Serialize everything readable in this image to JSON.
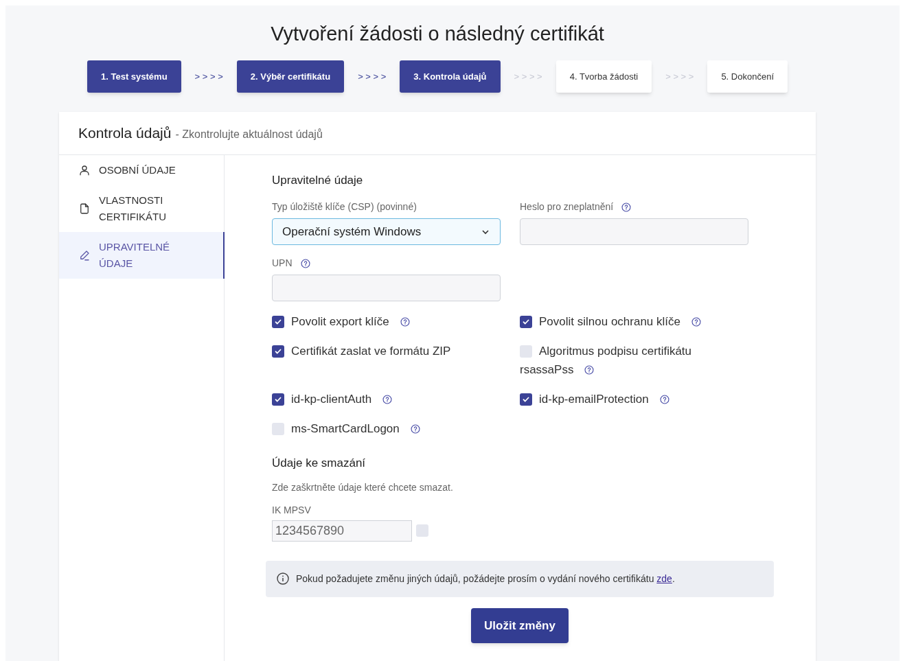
{
  "title": "Vytvoření žádosti o následný certifikát",
  "steps": [
    {
      "label": "1. Test systému",
      "done": true
    },
    {
      "separator": "> > > >",
      "active": true
    },
    {
      "label": "2. Výběr certifikátu",
      "done": true
    },
    {
      "separator": "> > > >",
      "active": true
    },
    {
      "label": "3. Kontrola údajů",
      "done": true
    },
    {
      "separator": "> > > >",
      "active": false
    },
    {
      "label": "4. Tvorba žádosti",
      "done": false
    },
    {
      "separator": "> > > >",
      "active": false
    },
    {
      "label": "5. Dokončení",
      "done": false
    }
  ],
  "card": {
    "title": "Kontrola údajů",
    "subtitle": "- Zkontrolujte aktuálnost údajů"
  },
  "sidebar": {
    "items": [
      {
        "kind": "person",
        "label": "OSOBNÍ ÚDAJE",
        "selected": false
      },
      {
        "kind": "document",
        "label": "VLASTNOSTI CERTIFIKÁTU",
        "selected": false
      },
      {
        "kind": "pencil",
        "label": "UPRAVITELNÉ ÚDAJE",
        "selected": true
      }
    ]
  },
  "editable": {
    "heading": "Upravitelné údaje",
    "fields": [
      {
        "kind": "select",
        "label": "Typ úložiště klíče (CSP) (povinné)",
        "value": "Operační systém Windows",
        "help": false
      },
      {
        "kind": "text",
        "label": "Heslo pro zneplatnění",
        "help": true
      },
      {
        "kind": "text",
        "label": "UPN",
        "help": true
      }
    ],
    "checkboxes": [
      {
        "label": "Povolit export klíče",
        "checked": true,
        "help": true
      },
      {
        "label": "Povolit silnou ochranu klíče",
        "checked": true,
        "help": true
      },
      {
        "label": "Certifikát zaslat ve formátu ZIP",
        "checked": true,
        "help": false
      },
      {
        "label": "Algoritmus podpisu certifikátu",
        "sublabel": "rsassaPss",
        "checked": false,
        "help": true
      },
      {
        "label": "id-kp-clientAuth",
        "checked": true,
        "help": true
      },
      {
        "label": "id-kp-emailProtection",
        "checked": true,
        "help": true
      },
      {
        "label": "ms-SmartCardLogon",
        "checked": false,
        "help": true
      }
    ]
  },
  "deletion": {
    "heading": "Údaje ke smazání",
    "hint": "Zde zaškrtněte údaje které chcete smazat.",
    "items": [
      {
        "label": "IK MPSV",
        "value": "1234567890",
        "checked": false
      }
    ]
  },
  "notice": {
    "text": "Pokud požadujete změnu jiných údajů, požádejte prosím o vydání nového certifikátu",
    "link": "zde",
    "end": "."
  },
  "save_button": "Uložit změny"
}
